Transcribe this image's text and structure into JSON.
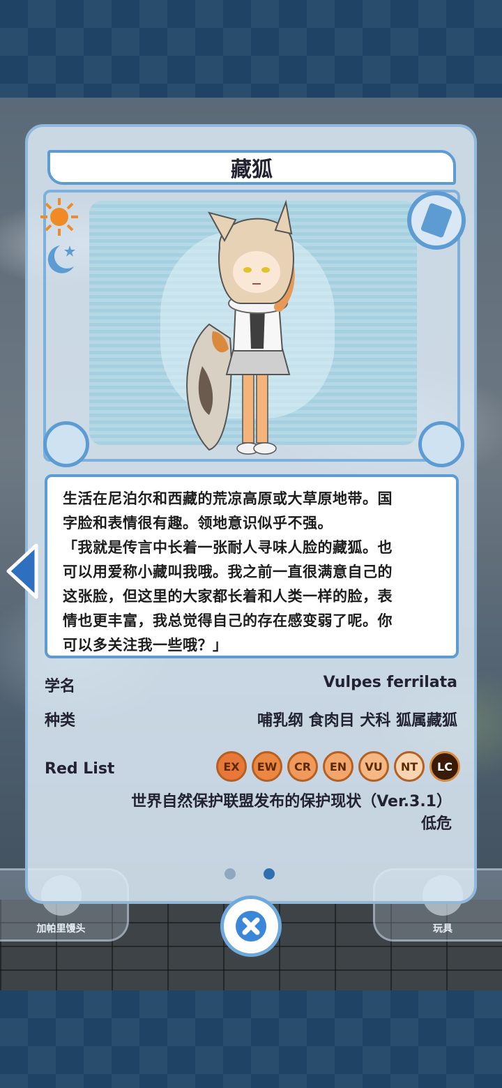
{
  "character": {
    "name": "藏狐"
  },
  "description": {
    "lines": [
      "生活在尼泊尔和西藏的荒凉高原或大草原地带。国",
      "字脸和表情很有趣。领地意识似乎不强。",
      "「我就是传言中长着一张耐人寻味人脸的藏狐。也",
      "可以用爱称小藏叫我哦。我之前一直很满意自己的",
      "这张脸，但这里的大家都长着和人类一样的脸，表",
      "情也更丰富，我总觉得自己的存在感变弱了呢。你",
      "可以多关注我一些哦？」"
    ]
  },
  "info": {
    "scientific_name_label": "学名",
    "scientific_name_value": "Vulpes ferrilata",
    "taxonomy_label": "种类",
    "taxonomy_value": "哺乳纲 食肉目 犬科 狐属藏狐"
  },
  "red_list": {
    "label": "Red List",
    "badges": [
      {
        "code": "EX",
        "color": "#e8773a",
        "active": false
      },
      {
        "code": "EW",
        "color": "#ec8742",
        "active": false
      },
      {
        "code": "CR",
        "color": "#f0995a",
        "active": false
      },
      {
        "code": "EN",
        "color": "#f2a66c",
        "active": false
      },
      {
        "code": "VU",
        "color": "#f5b884",
        "active": false
      },
      {
        "code": "NT",
        "color": "#f9d4b0",
        "active": false
      },
      {
        "code": "LC",
        "color": "#3a1a08",
        "active": true
      }
    ],
    "status_line": "世界自然保护联盟发布的保护现状（Ver.3.1）",
    "status_value": "低危"
  },
  "bottom_nav": {
    "left_label": "加帕里馒头",
    "right_label": "玩具"
  },
  "pager": {
    "count": 2,
    "active_index": 1
  },
  "colors": {
    "accent": "#5d9bd3",
    "dot_inactive": "#8fa8c0",
    "dot_active": "#2f6fb0",
    "close_x": "#3a86d8"
  }
}
